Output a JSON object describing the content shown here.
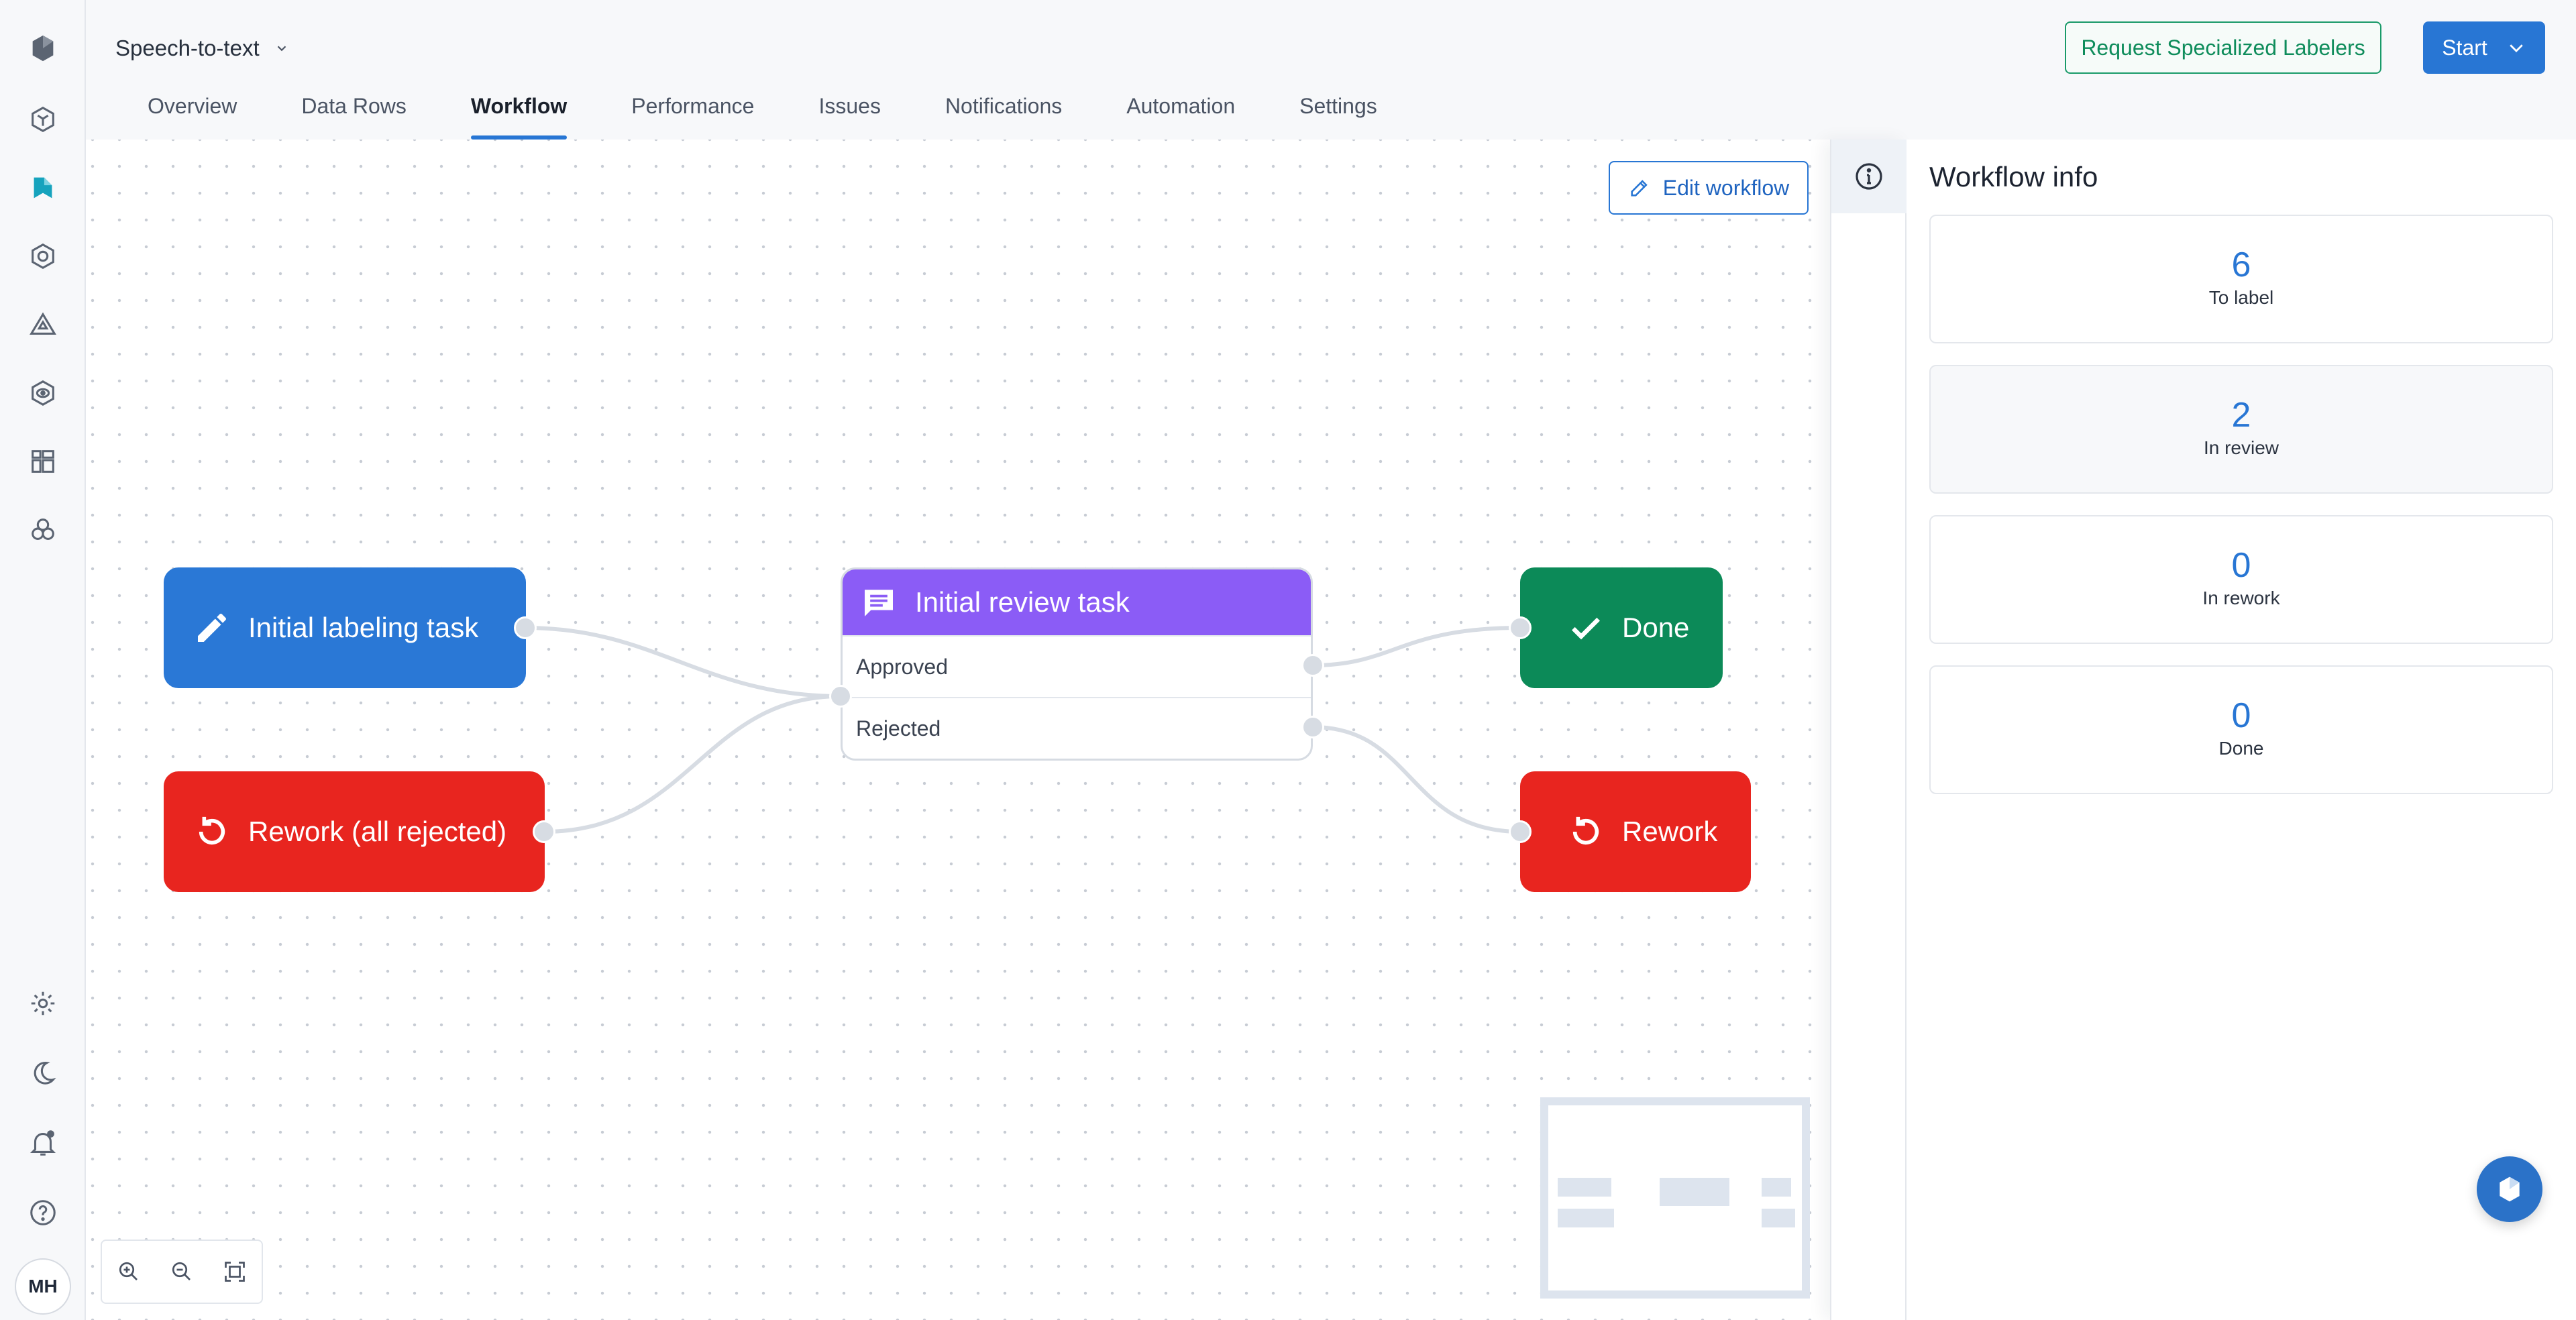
{
  "app": {
    "project_name": "Speech-to-text",
    "user_initials": "MH",
    "accent_color": "#2876d4"
  },
  "header": {
    "tabs": [
      {
        "label": "Overview",
        "active": false
      },
      {
        "label": "Data Rows",
        "active": false
      },
      {
        "label": "Workflow",
        "active": true
      },
      {
        "label": "Performance",
        "active": false
      },
      {
        "label": "Issues",
        "active": false
      },
      {
        "label": "Notifications",
        "active": false
      },
      {
        "label": "Automation",
        "active": false
      },
      {
        "label": "Settings",
        "active": false
      }
    ],
    "request_button_label": "Request Specialized Labelers",
    "start_button_label": "Start"
  },
  "rail": {
    "icons": [
      "logo-icon",
      "catalog-icon",
      "annotate-icon",
      "model-icon",
      "triangle-icon",
      "eye-icon",
      "grid-icon",
      "connections-icon",
      "gear-icon",
      "moon-icon",
      "bell-icon",
      "help-icon"
    ]
  },
  "canvas": {
    "edit_button_label": "Edit workflow",
    "nodes": {
      "initial_labeling": {
        "label": "Initial labeling task",
        "color": "#2a78d6",
        "icon": "pencil-icon"
      },
      "rework_all": {
        "label": "Rework (all rejected)",
        "color": "#e8251f",
        "icon": "rework-icon"
      },
      "review": {
        "label": "Initial review task",
        "color": "#8b5cf6",
        "icon": "comment-icon",
        "outputs": [
          "Approved",
          "Rejected"
        ]
      },
      "done": {
        "label": "Done",
        "color": "#0c8a58",
        "icon": "check-icon"
      },
      "rework": {
        "label": "Rework",
        "color": "#e8251f",
        "icon": "rework-icon"
      }
    }
  },
  "panel": {
    "title": "Workflow info",
    "stats": [
      {
        "value": "6",
        "label": "To label"
      },
      {
        "value": "2",
        "label": "In review"
      },
      {
        "value": "0",
        "label": "In rework"
      },
      {
        "value": "0",
        "label": "Done"
      }
    ]
  }
}
